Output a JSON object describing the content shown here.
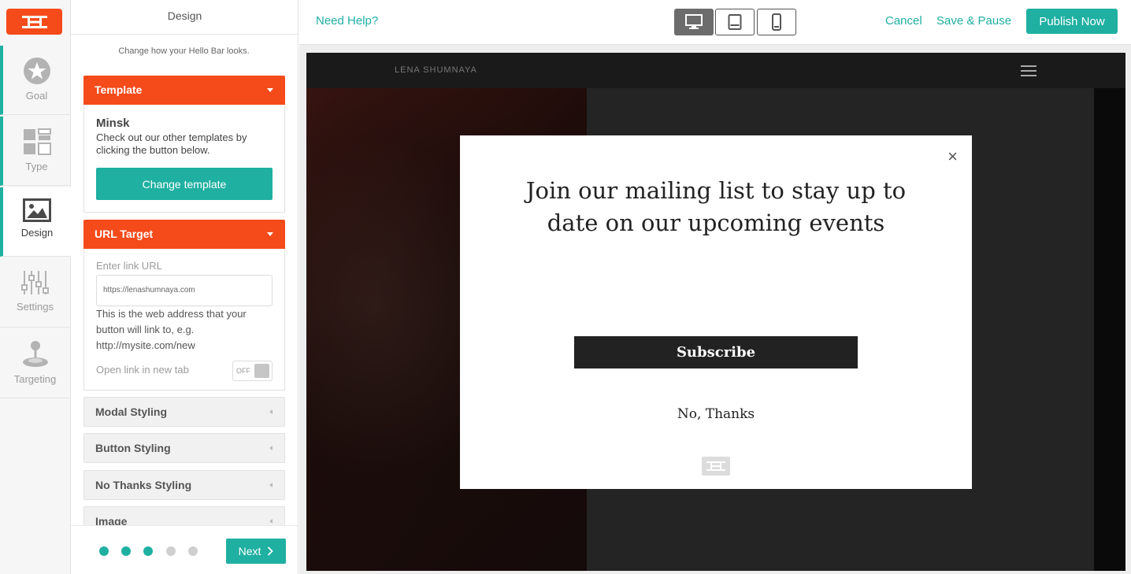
{
  "rail": {
    "logo_icon": "hellobar-logo-icon",
    "items": [
      {
        "label": "Goal",
        "icon": "star-icon"
      },
      {
        "label": "Type",
        "icon": "layout-icon"
      },
      {
        "label": "Design",
        "icon": "image-icon"
      },
      {
        "label": "Settings",
        "icon": "sliders-icon"
      },
      {
        "label": "Targeting",
        "icon": "joystick-icon"
      }
    ]
  },
  "panel": {
    "title": "Design",
    "subtitle": "Change how your Hello Bar looks.",
    "template": {
      "header": "Template",
      "name": "Minsk",
      "description": "Check out our other templates by clicking the button below.",
      "button": "Change template"
    },
    "url_target": {
      "header": "URL Target",
      "label": "Enter link URL",
      "value": "https://lenashumnaya.com",
      "help": "This is the web address that your button will link to, e.g. http://mysite.com/new",
      "new_tab_label": "Open link in new tab",
      "toggle_state": "OFF"
    },
    "collapsed_sections": [
      "Modal Styling",
      "Button Styling",
      "No Thanks Styling",
      "Image"
    ],
    "progress": {
      "total_steps": 5,
      "completed_steps": 3
    },
    "next_button": "Next"
  },
  "topbar": {
    "help": "Need Help?",
    "devices": [
      "desktop-icon",
      "tablet-icon",
      "mobile-icon"
    ],
    "selected_device": "desktop",
    "cancel": "Cancel",
    "save_pause": "Save & Pause",
    "publish": "Publish Now"
  },
  "preview": {
    "site_name": "LENA SHUMNAYA",
    "modal": {
      "headline": "Join our mailing list to stay up to date on our upcoming events",
      "cta": "Subscribe",
      "no_thanks": "No, Thanks",
      "close": "×"
    }
  },
  "colors": {
    "accent": "#1fb0a2",
    "brand_orange": "#f54b1a"
  }
}
